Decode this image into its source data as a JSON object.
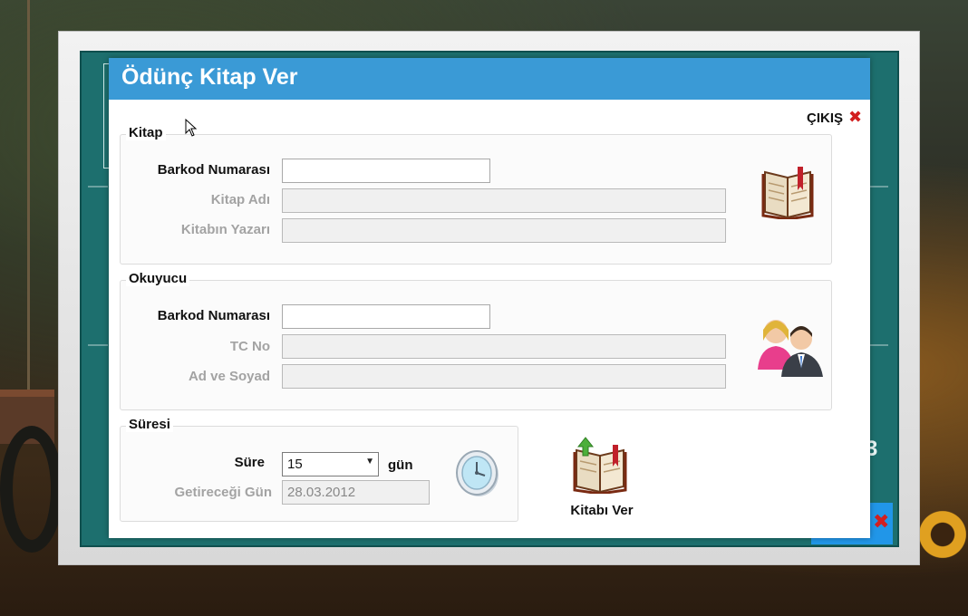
{
  "dialog": {
    "title": "Ödünç Kitap Ver",
    "exit_label": "ÇIKIŞ"
  },
  "book_group": {
    "title": "Kitap",
    "barcode_label": "Barkod Numarası",
    "barcode_value": "",
    "name_label": "Kitap Adı",
    "name_value": "",
    "author_label": "Kitabın Yazarı",
    "author_value": ""
  },
  "reader_group": {
    "title": "Okuyucu",
    "barcode_label": "Barkod Numarası",
    "barcode_value": "",
    "tc_label": "TC No",
    "tc_value": "",
    "name_label": "Ad ve Soyad",
    "name_value": ""
  },
  "duration_group": {
    "title": "Süresi",
    "duration_label": "Süre",
    "duration_value": "15",
    "unit_label": "gün",
    "return_label": "Getireceği Gün",
    "return_value": "28.03.2012"
  },
  "give_button": {
    "label": "Kitabı Ver"
  },
  "background": {
    "partial_number": "3"
  },
  "colors": {
    "title_bar": "#3a9ad6",
    "teal_panel": "#1d6f6e",
    "close_red": "#d21f1f"
  },
  "icons": {
    "exit": "close-x-icon",
    "book": "open-book-icon",
    "users": "users-icon",
    "clock": "clock-icon",
    "give": "give-book-icon"
  }
}
